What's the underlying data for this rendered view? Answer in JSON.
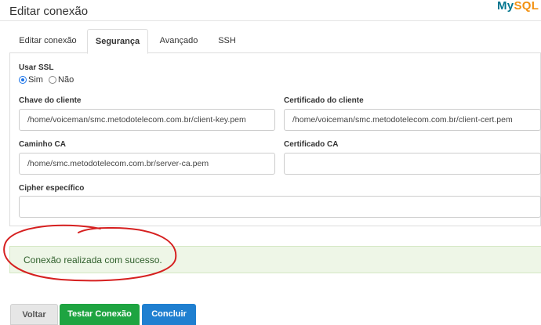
{
  "header": {
    "title": "Editar conexão",
    "logo_text": "MySQL"
  },
  "tabs": [
    {
      "label": "Editar conexão",
      "active": false
    },
    {
      "label": "Segurança",
      "active": true
    },
    {
      "label": "Avançado",
      "active": false
    },
    {
      "label": "SSH",
      "active": false
    }
  ],
  "security": {
    "ssl_label": "Usar SSL",
    "ssl_options": [
      {
        "label": "Sim",
        "checked": true
      },
      {
        "label": "Não",
        "checked": false
      }
    ],
    "client_key_label": "Chave do cliente",
    "client_key_value": "/home/voiceman/smc.metodotelecom.com.br/client-key.pem",
    "client_cert_label": "Certificado do cliente",
    "client_cert_value": "/home/voiceman/smc.metodotelecom.com.br/client-cert.pem",
    "ca_path_label": "Caminho CA",
    "ca_path_value": "/home/smc.metodotelecom.com.br/server-ca.pem",
    "ca_cert_label": "Certificado CA",
    "ca_cert_value": "",
    "cipher_label": "Cipher específico",
    "cipher_value": ""
  },
  "alert": {
    "message": "Conexão realizada com sucesso.",
    "color": "#eef6e7"
  },
  "buttons": {
    "back": "Voltar",
    "test": "Testar Conexão",
    "finish": "Concluir"
  },
  "colors": {
    "test_button": "#1ea441",
    "finish_button": "#1f7fd0",
    "annotation": "#d62020"
  }
}
